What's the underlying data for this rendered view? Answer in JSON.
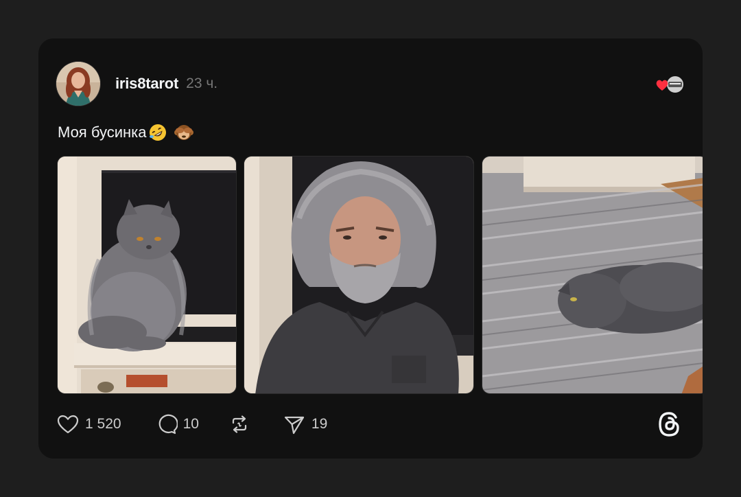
{
  "post": {
    "username": "iris8tarot",
    "time": "23 ч.",
    "text": "Моя бусинка",
    "text_emojis": [
      "rolling-on-floor-laughing-emoji",
      "see-no-evil-monkey-emoji"
    ],
    "media": [
      {
        "name": "post-image-cat-sitting",
        "description": "grey fluffy cat sitting on a shelf"
      },
      {
        "name": "post-image-man-grey-hair",
        "description": "man with messy grey hair and beard"
      },
      {
        "name": "post-image-cat-lying",
        "description": "grey fluffy cat lying on a rug"
      }
    ]
  },
  "actions": {
    "likes": "1 520",
    "replies": "10",
    "reposts": "",
    "shares": "19"
  },
  "icons": {
    "like": "heart-icon",
    "reply": "speech-bubble-icon",
    "repost": "repost-icon",
    "share": "send-icon",
    "brand": "threads-logo-icon"
  },
  "colors": {
    "background": "#1e1e1e",
    "card": "#111111",
    "text_primary": "#f3f5f7",
    "text_secondary": "#777777",
    "like_heart": "#ff3040"
  }
}
